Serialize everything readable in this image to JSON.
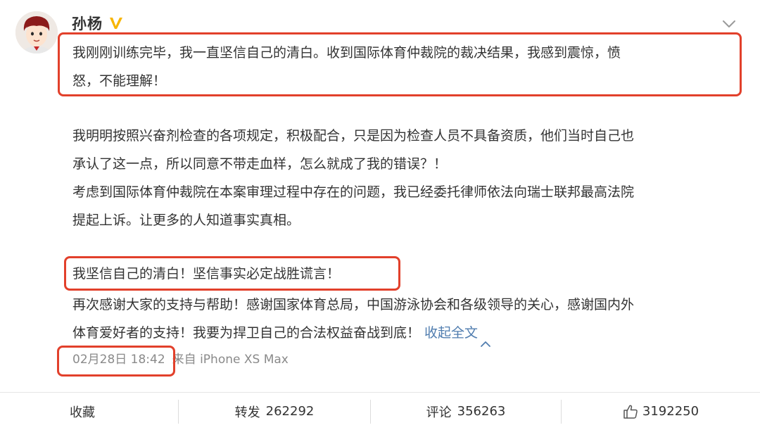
{
  "user": {
    "name": "孙杨"
  },
  "post": {
    "para1": [
      "我刚刚训练完毕，我一直坚信自己的清白。收到国际体育仲裁院的裁决结果，我感到震惊，愤",
      "怒，不能理解！"
    ],
    "para2": [
      "我明明按照兴奋剂检查的各项规定，积极配合，只是因为检查人员不具备资质，他们当时自己也",
      "承认了这一点，所以同意不带走血样，怎么就成了我的错误？！"
    ],
    "para3": [
      "考虑到国际体育仲裁院在本案审理过程中存在的问题，我已经委托律师依法向瑞士联邦最高法院",
      "提起上诉。让更多的人知道事实真相。"
    ],
    "para4": "我坚信自己的清白！坚信事实必定战胜谎言！",
    "para5": [
      "再次感谢大家的支持与帮助！感谢国家体育总局，中国游泳协会和各级领导的关心，感谢国内外",
      "体育爱好者的支持！我要为捍卫自己的合法权益奋战到底！"
    ],
    "collapse_label": "收起全文",
    "time": "02月28日 18:42",
    "source": "来自 iPhone XS Max"
  },
  "actions": {
    "favorite_label": "收藏",
    "repost_label": "转发",
    "repost_count": "262292",
    "comment_label": "评论",
    "comment_count": "356263",
    "like_count": "3192250"
  },
  "colors": {
    "highlight": "#e2402b",
    "link": "#507daf",
    "verified": "#f7b500",
    "meta": "#8a8a8a"
  },
  "icons": {
    "verified": "verified-badge-icon",
    "dropdown": "chevron-down-icon",
    "collapse": "chevron-up-icon",
    "like": "thumbs-up-icon"
  }
}
